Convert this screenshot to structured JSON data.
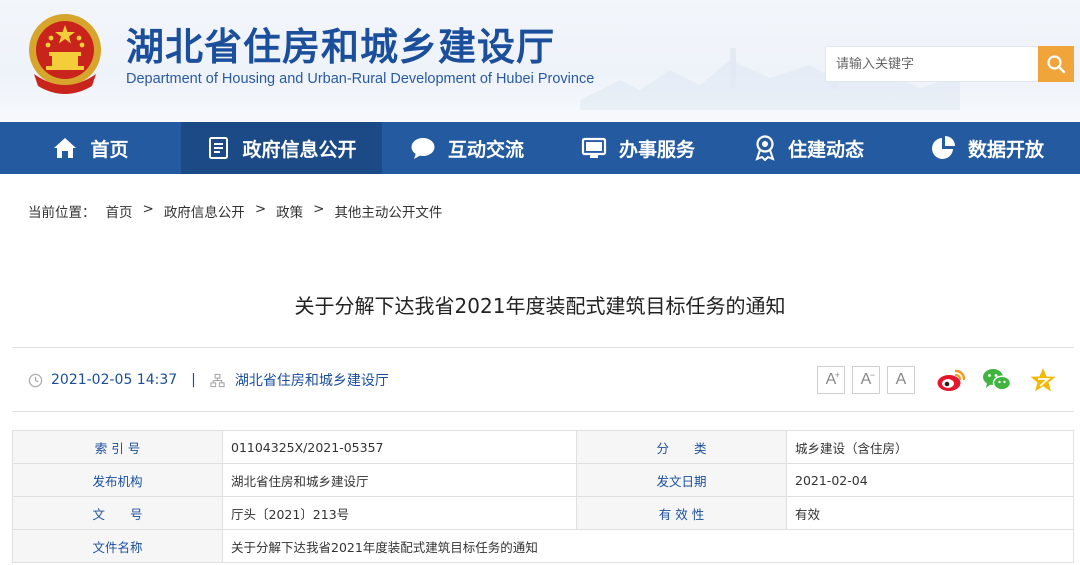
{
  "header": {
    "title": "湖北省住房和城乡建设厅",
    "subtitle": "Department of Housing and Urban-Rural Development of Hubei Province",
    "search_placeholder": "请输入关键字",
    "accent_color": "#f0a43a",
    "brand_color": "#1b4f9c"
  },
  "nav": {
    "background": "#245aa0",
    "items": [
      {
        "label": "首页",
        "icon": "home-icon"
      },
      {
        "label": "政府信息公开",
        "icon": "document-icon",
        "active": true
      },
      {
        "label": "互动交流",
        "icon": "chat-bubble-icon"
      },
      {
        "label": "办事服务",
        "icon": "monitor-icon"
      },
      {
        "label": "住建动态",
        "icon": "award-icon"
      },
      {
        "label": "数据开放",
        "icon": "pie-chart-icon"
      }
    ]
  },
  "breadcrumb": {
    "prefix": "当前位置：",
    "items": [
      "首页",
      "政府信息公开",
      "政策",
      "其他主动公开文件"
    ],
    "separator": ">"
  },
  "article": {
    "title": "关于分解下达我省2021年度装配式建筑目标任务的通知",
    "datetime": "2021-02-05 14:37",
    "divider": "|",
    "source": "湖北省住房和城乡建设厅",
    "font_controls": [
      "A+",
      "A-",
      "A"
    ],
    "share_icons": [
      "weibo-icon",
      "wechat-icon",
      "favorite-star-icon"
    ]
  },
  "info_table": {
    "rows": [
      {
        "label1": "索 引 号",
        "value1": "01104325X/2021-05357",
        "label2": "分　　类",
        "value2": "城乡建设（含住房）"
      },
      {
        "label1": "发布机构",
        "value1": "湖北省住房和城乡建设厅",
        "label2": "发文日期",
        "value2": "2021-02-04"
      },
      {
        "label1": "文　　号",
        "value1": "厅头〔2021〕213号",
        "label2": "有 效 性",
        "value2": "有效"
      },
      {
        "label1": "文件名称",
        "value1": "关于分解下达我省2021年度装配式建筑目标任务的通知"
      }
    ]
  }
}
